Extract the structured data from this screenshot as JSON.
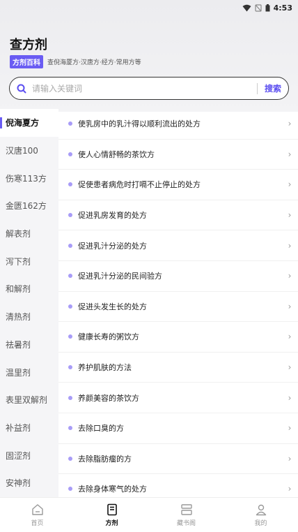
{
  "status": {
    "time": "4:53"
  },
  "header": {
    "title": "查方剂",
    "badge": "方剂百科",
    "subtitle": "查倪海厦方·汉唐方·经方·常用方等"
  },
  "search": {
    "placeholder": "请输入关键词",
    "button": "搜索"
  },
  "sidebar": {
    "items": [
      {
        "label": "倪海夏方",
        "active": true
      },
      {
        "label": "汉唐100"
      },
      {
        "label": "伤寒113方"
      },
      {
        "label": "金匮162方"
      },
      {
        "label": "解表剂"
      },
      {
        "label": "泻下剂"
      },
      {
        "label": "和解剂"
      },
      {
        "label": "清热剂"
      },
      {
        "label": "祛暑剂"
      },
      {
        "label": "温里剂"
      },
      {
        "label": "表里双解剂"
      },
      {
        "label": "补益剂"
      },
      {
        "label": "固涩剂"
      },
      {
        "label": "安神剂"
      }
    ]
  },
  "list": {
    "items": [
      "使乳房中的乳汁得以顺利流出的处方",
      "使人心情舒畅的茶饮方",
      "促使患者病危时打嗝不止停止的处方",
      "促进乳房发育的处方",
      "促进乳汁分泌的处方",
      "促进乳汁分泌的民间验方",
      "促进头发生长的处方",
      "健康长寿的粥饮方",
      "养护肌肤的方法",
      "养颜美容的茶饮方",
      "去除口臭的方",
      "去除脂肪瘤的方",
      "去除身体寒气的处方"
    ]
  },
  "tabs": [
    {
      "label": "首页",
      "icon": "home-icon"
    },
    {
      "label": "方剂",
      "icon": "book-icon",
      "active": true
    },
    {
      "label": "藏书阁",
      "icon": "bookshelf-icon"
    },
    {
      "label": "我的",
      "icon": "user-icon"
    }
  ],
  "colors": {
    "accent": "#6a5cf3",
    "dot": "#a89cf7"
  }
}
